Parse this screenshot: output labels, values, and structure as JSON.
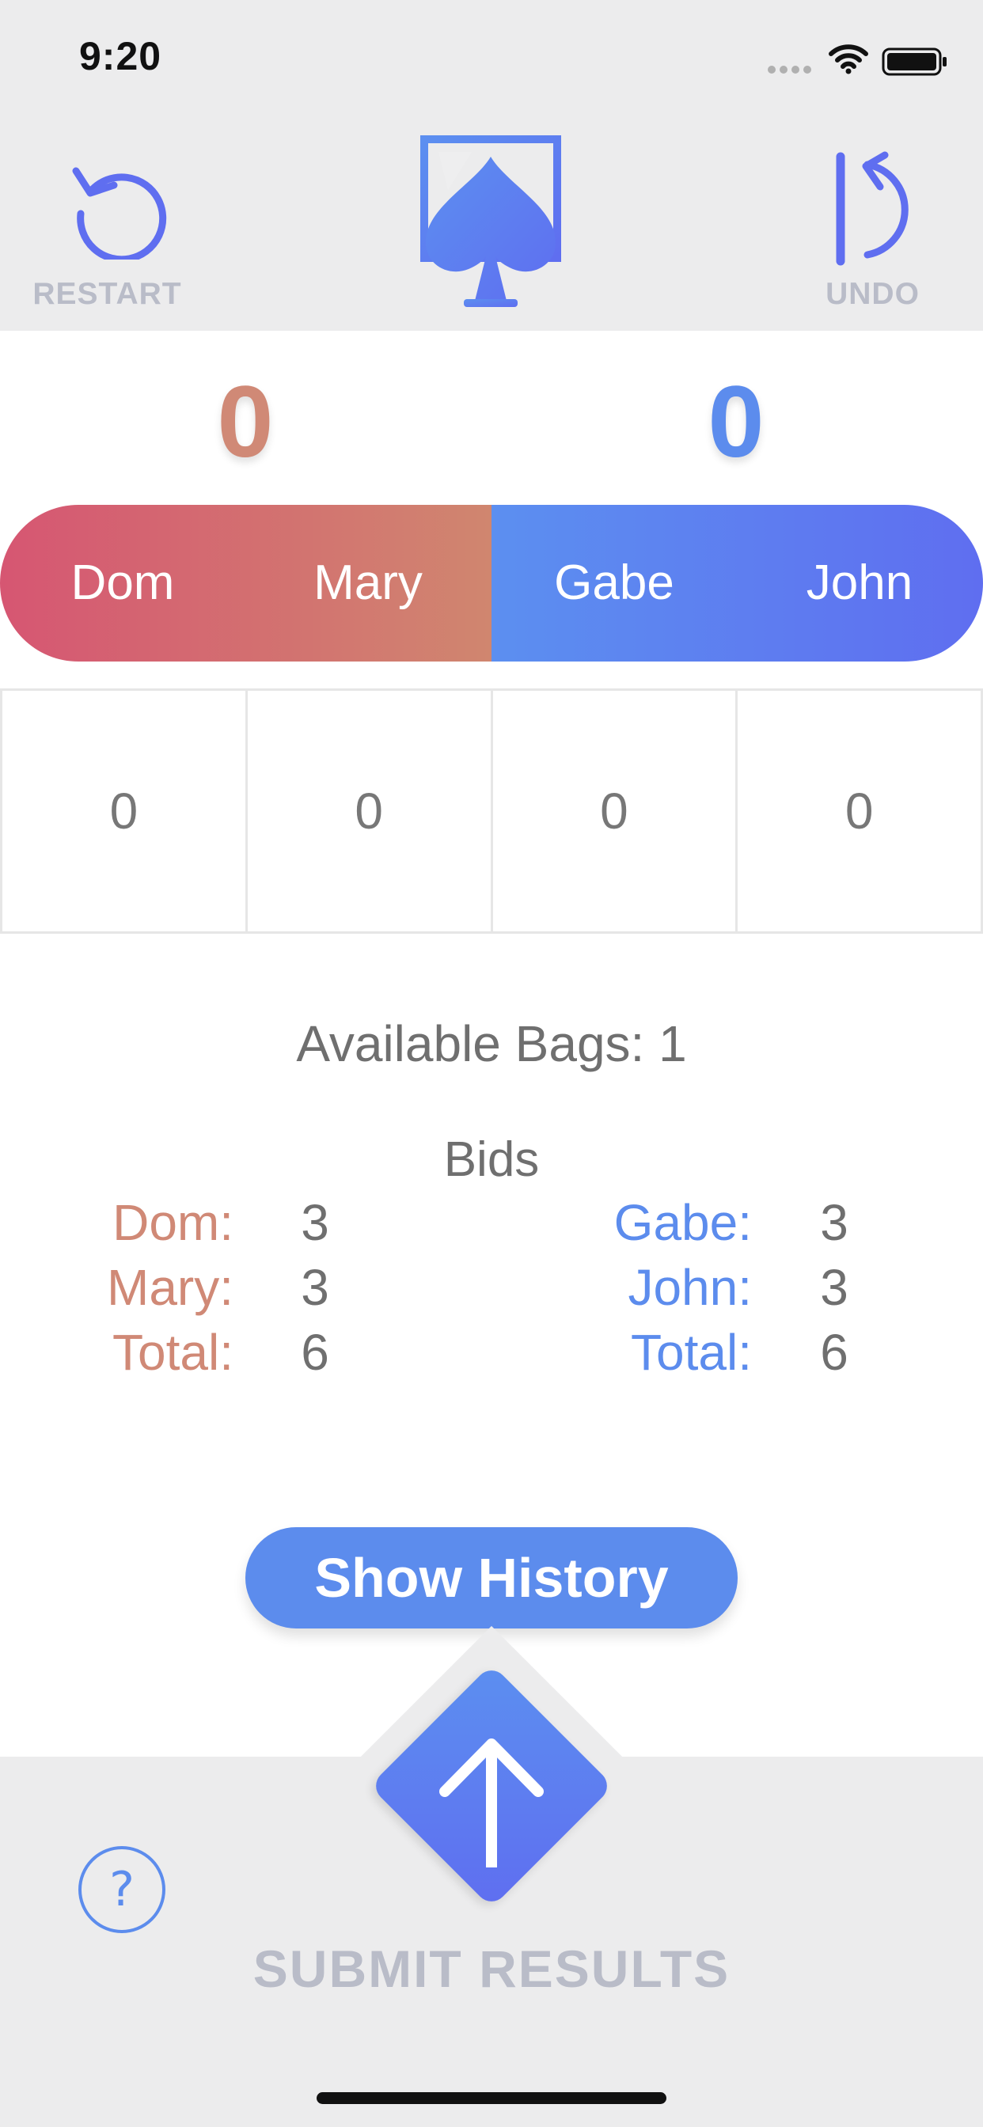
{
  "status_bar": {
    "time": "9:20"
  },
  "header": {
    "restart_label": "RESTART",
    "undo_label": "UNDO"
  },
  "scores": {
    "team_left": "0",
    "team_right": "0"
  },
  "players": [
    "Dom",
    "Mary",
    "Gabe",
    "John"
  ],
  "tricks": [
    "0",
    "0",
    "0",
    "0"
  ],
  "bags": {
    "text": "Available Bags: 1"
  },
  "bids": {
    "heading": "Bids",
    "left": [
      {
        "label": "Dom:",
        "value": "3"
      },
      {
        "label": "Mary:",
        "value": "3"
      },
      {
        "label": "Total:",
        "value": "6"
      }
    ],
    "right": [
      {
        "label": "Gabe:",
        "value": "3"
      },
      {
        "label": "John:",
        "value": "3"
      },
      {
        "label": "Total:",
        "value": "6"
      }
    ]
  },
  "actions": {
    "show_history": "Show History",
    "submit": "SUBMIT RESULTS"
  },
  "colors": {
    "team_left": "#d08976",
    "team_right": "#5c8ced",
    "accent": "#5c8ced",
    "muted": "#b9bcc8"
  },
  "icons": [
    "restart-icon",
    "spade-logo-icon",
    "undo-icon",
    "help-icon",
    "submit-arrow-icon",
    "wifi-icon",
    "battery-icon"
  ]
}
